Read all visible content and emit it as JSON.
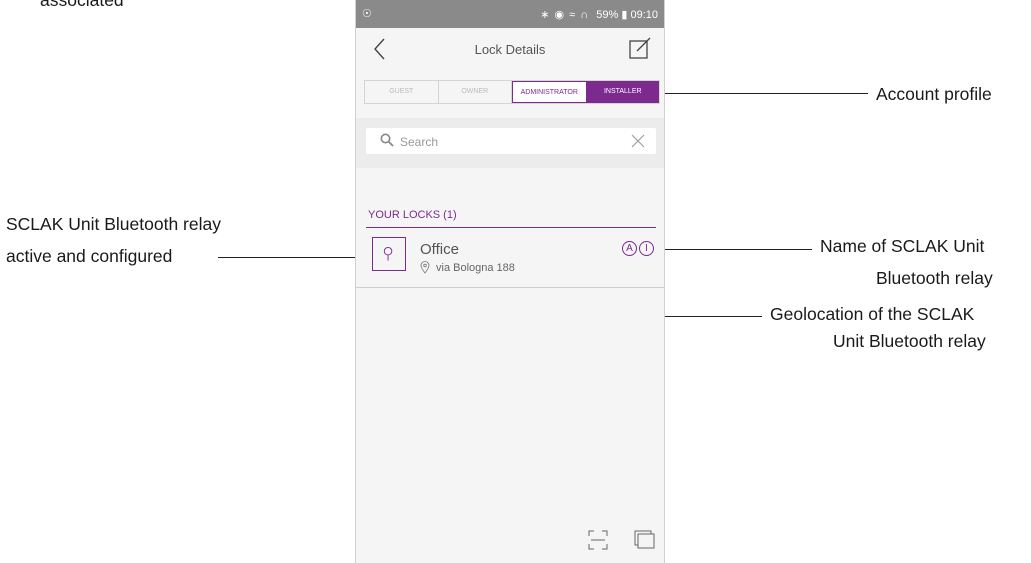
{
  "status_bar": {
    "left_icon": "account-circle-icon",
    "icons": "bluetooth alarm wifi signal",
    "battery": "59%",
    "time": "09:10"
  },
  "header": {
    "title": "Lock Details",
    "back_icon": "chevron-left-icon",
    "edit_icon": "edit-icon"
  },
  "profiles": {
    "tabs": [
      "GUEST",
      "OWNER",
      "ADMINISTRATOR",
      "INSTALLER"
    ],
    "selected": "INSTALLER"
  },
  "search": {
    "placeholder": "Search"
  },
  "locks": {
    "header": "YOUR LOCKS (1)",
    "items": [
      {
        "name": "Office",
        "address": "via Bologna 188",
        "badges": [
          "A",
          "I"
        ]
      }
    ]
  },
  "annotations": {
    "top_cut": "associated",
    "left_line1": "SCLAK Unit Bluetooth relay",
    "left_line2": "active and configured",
    "account_profile": "Account profile",
    "name_line1": "Name of SCLAK Unit",
    "name_line2": "Bluetooth relay",
    "geo_line1": "Geolocation of the SCLAK",
    "geo_line2": "Unit Bluetooth relay"
  },
  "colors": {
    "accent": "#7c2a8e",
    "status_bar": "#8a8a8a"
  }
}
